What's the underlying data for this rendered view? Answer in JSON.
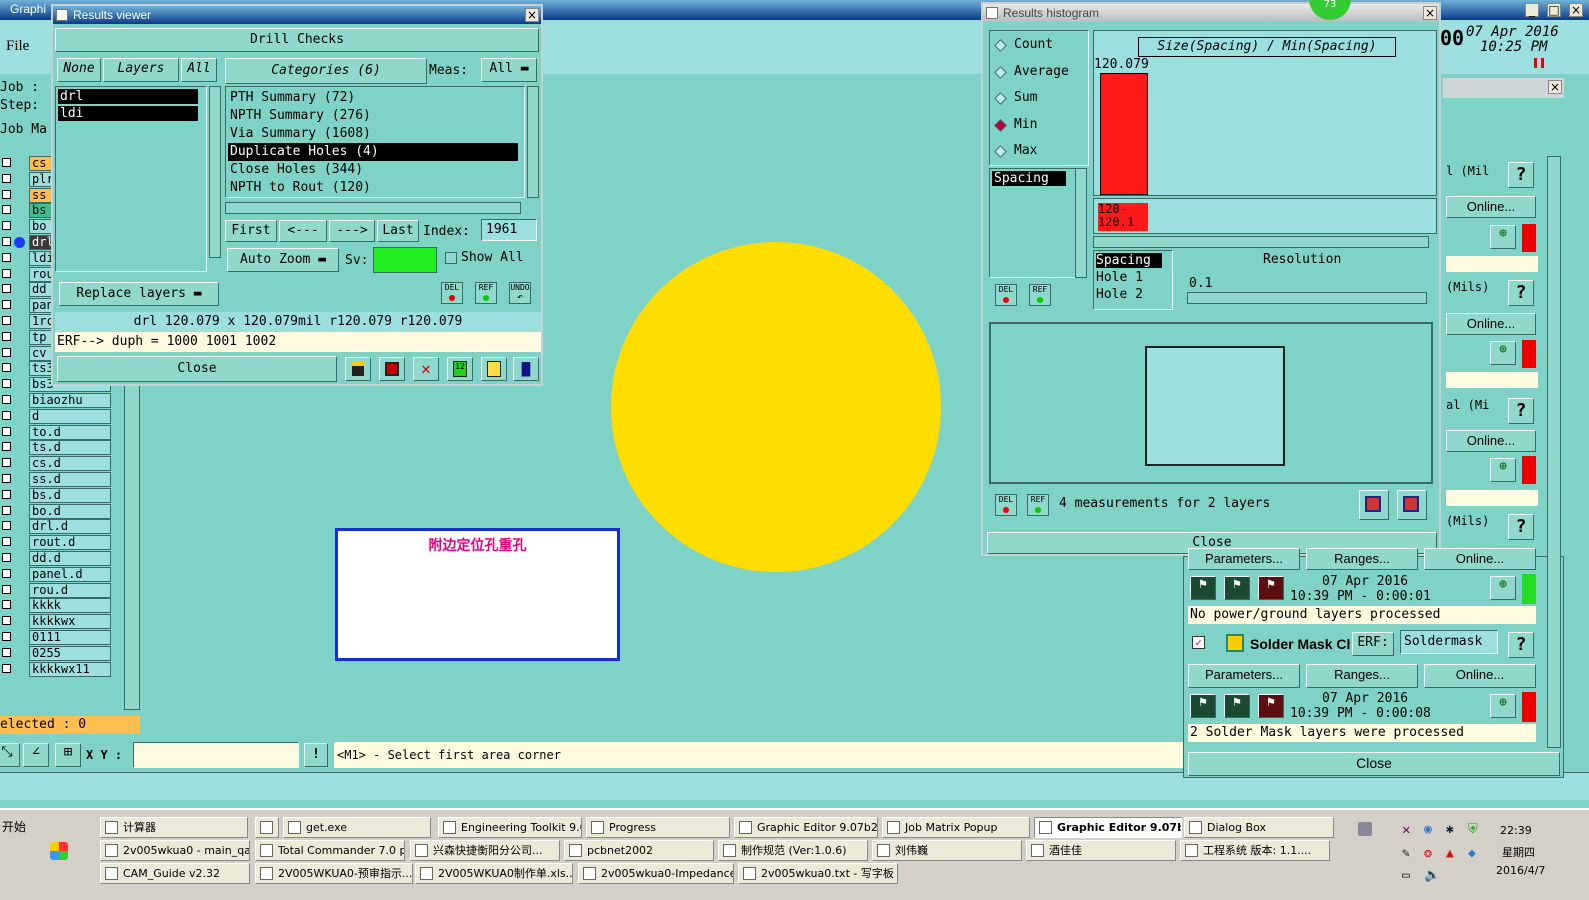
{
  "colors": {
    "teal": "#7fd3c6",
    "cyan": "#9bdfde",
    "yellow": "#ffdd00",
    "red": "#ff1a1a",
    "green": "#22ee22",
    "magenta": "#e0007f"
  },
  "main": {
    "title": "Graphi",
    "menu_file": "File",
    "job_label": "Job :",
    "step_label": "Step:",
    "job_matrix_label": "Job Ma",
    "layers": [
      "cs",
      "plr",
      "ss",
      "bs",
      "bo",
      "drl",
      "ldi",
      "rou",
      "dd",
      "pan",
      "1rc",
      "tp",
      "cv",
      "ts3",
      "bs3",
      "biaozhu",
      "d",
      "to.d",
      "ts.d",
      "cs.d",
      "ss.d",
      "bs.d",
      "bo.d",
      "drl.d",
      "rout.d",
      "dd.d",
      "panel.d",
      "rou.d",
      "kkkk",
      "kkkkwx",
      "0111",
      "0255",
      "kkkkwx11"
    ],
    "selected": "elected : 0",
    "xy_label": "X Y :",
    "prompt": "<M1> - Select first area corner",
    "date": "07 Apr 2016",
    "time": "10:25 PM",
    "date_prefix": "00",
    "annotation": "附边定位孔重孔"
  },
  "results_viewer": {
    "title": "Results viewer",
    "header": "Drill Checks",
    "none_btn": "None",
    "layers_btn": "Layers",
    "all_btn": "All",
    "categories_btn": "Categories (6)",
    "meas_label": "Meas:",
    "meas_value": "All",
    "layers": [
      "drl",
      "ldi"
    ],
    "categories": [
      "PTH Summary (72)",
      "NPTH Summary (276)",
      "Via Summary (1608)",
      "Duplicate Holes (4)",
      "Close Holes (344)",
      "NPTH to Rout (120)"
    ],
    "selected_category": "Duplicate Holes (4)",
    "first_btn": "First",
    "prev_btn": "<---",
    "next_btn": "--->",
    "last_btn": "Last",
    "index_label": "Index:",
    "index_value": "1961",
    "auto_zoom": "Auto Zoom",
    "sv_label": "Sv:",
    "show_all": "Show All",
    "replace_layers": "Replace layers",
    "del_icon": "DEL",
    "ref_icon": "REF",
    "undo_icon": "UNDO",
    "info_line": "drl 120.079 x 120.079mil  r120.079  r120.079",
    "erf_line": "ERF--> duph = 1000 1001 1002",
    "close_btn": "Close"
  },
  "histogram": {
    "title": "Results histogram",
    "badge": "73",
    "radio_options": [
      "Count",
      "Average",
      "Sum",
      "Min",
      "Max"
    ],
    "selected_radio": "Min",
    "chart_title": "Size(Spacing) / Min(Spacing)",
    "bar_value": "120.079",
    "bar_label": "120-\n120.1",
    "spacing_list": [
      "Spacing"
    ],
    "spacing_table": [
      "Spacing",
      "Hole 1",
      "Hole 2"
    ],
    "resolution_label": "Resolution",
    "resolution_value": "0.1",
    "measurements": "4 measurements for 2 layers",
    "close_btn": "Close",
    "del_icon": "DEL",
    "ref_icon": "REF"
  },
  "right_panel": {
    "labels": [
      "l (Mil",
      "(Mils)",
      "al (Mi",
      "(Mils)"
    ],
    "online_btn": "Online...",
    "parameters_btn": "Parameters...",
    "ranges_btn": "Ranges...",
    "date1": "07 Apr 2016",
    "time1": "10:39 PM - 0:00:01",
    "status1": "No power/ground layers processed",
    "solder_title": "Solder Mask Ch",
    "erf_label": "ERF:",
    "erf_value": "Soldermask",
    "date2": "07 Apr 2016",
    "time2": "10:39 PM - 0:00:08",
    "status2": "2 Solder Mask layers were processed",
    "close_btn": "Close",
    "help": "?"
  },
  "taskbar": {
    "start": "开始",
    "row1": [
      "计算器",
      "",
      "get.exe",
      "Engineering Toolkit 9.0...",
      "Progress",
      "Graphic Editor 9.07b2 (...",
      "Job Matrix Popup",
      "Graphic Editor 9.07b...",
      "Dialog Box"
    ],
    "row2": [
      "2v005wkua0 - main_qa",
      "Total Commander 7.0 p...",
      "兴森快捷衡阳分公司...",
      "pcbnet2002",
      "制作规范 (Ver:1.0.6)",
      "刘伟巍",
      "酒佳佳",
      "工程系统  版本: 1.1...."
    ],
    "row3": [
      "CAM_Guide v2.32",
      "2V005WKUA0-预审指示...",
      "2V005WKUA0制作单.xls...",
      "2v005wkua0-Impedance...",
      "2v005wkua0.txt - 写字板"
    ],
    "active": "Graphic Editor 9.07b...",
    "clock": "22:39",
    "weekday": "星期四",
    "date": "2016/4/7"
  }
}
